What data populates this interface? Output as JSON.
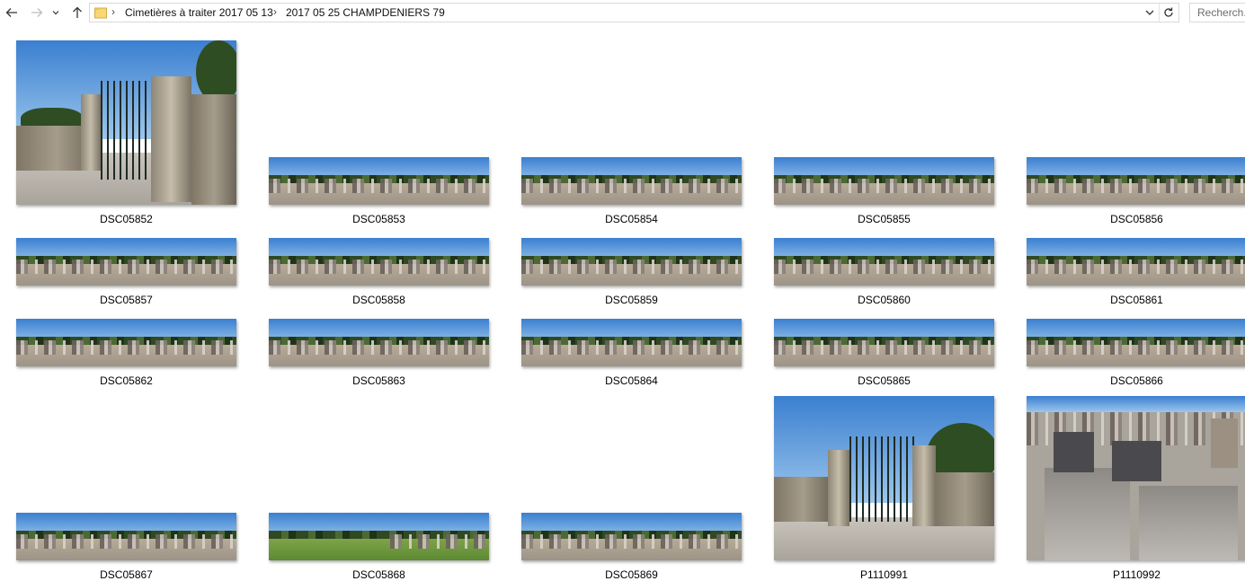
{
  "toolbar": {
    "back_icon": "arrow-left-icon",
    "forward_icon": "arrow-right-icon",
    "recent_icon": "chevron-down-icon",
    "up_icon": "arrow-up-icon",
    "refresh_icon": "refresh-icon"
  },
  "address": {
    "folder_icon": "folder-icon",
    "crumbs": [
      "Cimetières à traiter 2017 05 13",
      "2017 05 25 CHAMPDENIERS 79"
    ]
  },
  "search": {
    "placeholder": "Recherch."
  },
  "files": [
    {
      "name": "DSC05852",
      "kind": "photo-gate"
    },
    {
      "name": "DSC05853",
      "kind": "panorama"
    },
    {
      "name": "DSC05854",
      "kind": "panorama"
    },
    {
      "name": "DSC05855",
      "kind": "panorama"
    },
    {
      "name": "DSC05856",
      "kind": "panorama"
    },
    {
      "name": "DSC05857",
      "kind": "panorama"
    },
    {
      "name": "DSC05858",
      "kind": "panorama"
    },
    {
      "name": "DSC05859",
      "kind": "panorama"
    },
    {
      "name": "DSC05860",
      "kind": "panorama"
    },
    {
      "name": "DSC05861",
      "kind": "panorama"
    },
    {
      "name": "DSC05862",
      "kind": "panorama"
    },
    {
      "name": "DSC05863",
      "kind": "panorama"
    },
    {
      "name": "DSC05864",
      "kind": "panorama"
    },
    {
      "name": "DSC05865",
      "kind": "panorama"
    },
    {
      "name": "DSC05866",
      "kind": "panorama"
    },
    {
      "name": "DSC05867",
      "kind": "panorama"
    },
    {
      "name": "DSC05868",
      "kind": "panorama-grass"
    },
    {
      "name": "DSC05869",
      "kind": "panorama"
    },
    {
      "name": "P1110991",
      "kind": "photo-gate"
    },
    {
      "name": "P1110992",
      "kind": "photo-graves"
    }
  ]
}
